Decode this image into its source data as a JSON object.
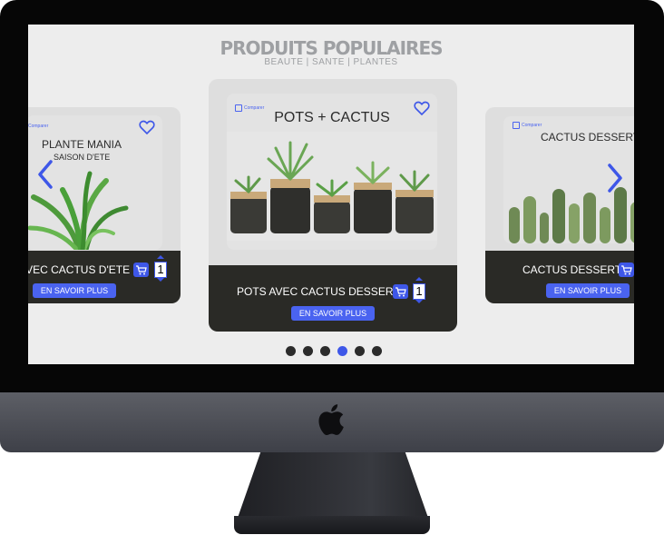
{
  "header": {
    "title": "PRODUITS POPULAIRES",
    "subtitle": "BEAUTE | SANTE | PLANTES"
  },
  "cards": [
    {
      "title": "PLANTE MANIA",
      "subtitle": "SAISON D'ETE",
      "compare_label": "Comparer",
      "product_name": "AVEC CACTUS D'ETE",
      "quantity": "1",
      "button_label": "EN SAVOIR PLUS"
    },
    {
      "title": "POTS + CACTUS",
      "compare_label": "Comparer",
      "product_name": "POTS AVEC CACTUS DESSERT",
      "quantity": "1",
      "button_label": "EN SAVOIR PLUS"
    },
    {
      "title": "CACTUS DESSERT",
      "compare_label": "Comparer",
      "product_name": "CACTUS DESSERT",
      "button_label": "EN SAVOIR PLUS"
    }
  ],
  "carousel": {
    "dot_count": 6,
    "active_index": 3
  },
  "colors": {
    "accent": "#3e57e8",
    "dark_panel": "#2a2a26",
    "screen_bg": "#ededed"
  }
}
